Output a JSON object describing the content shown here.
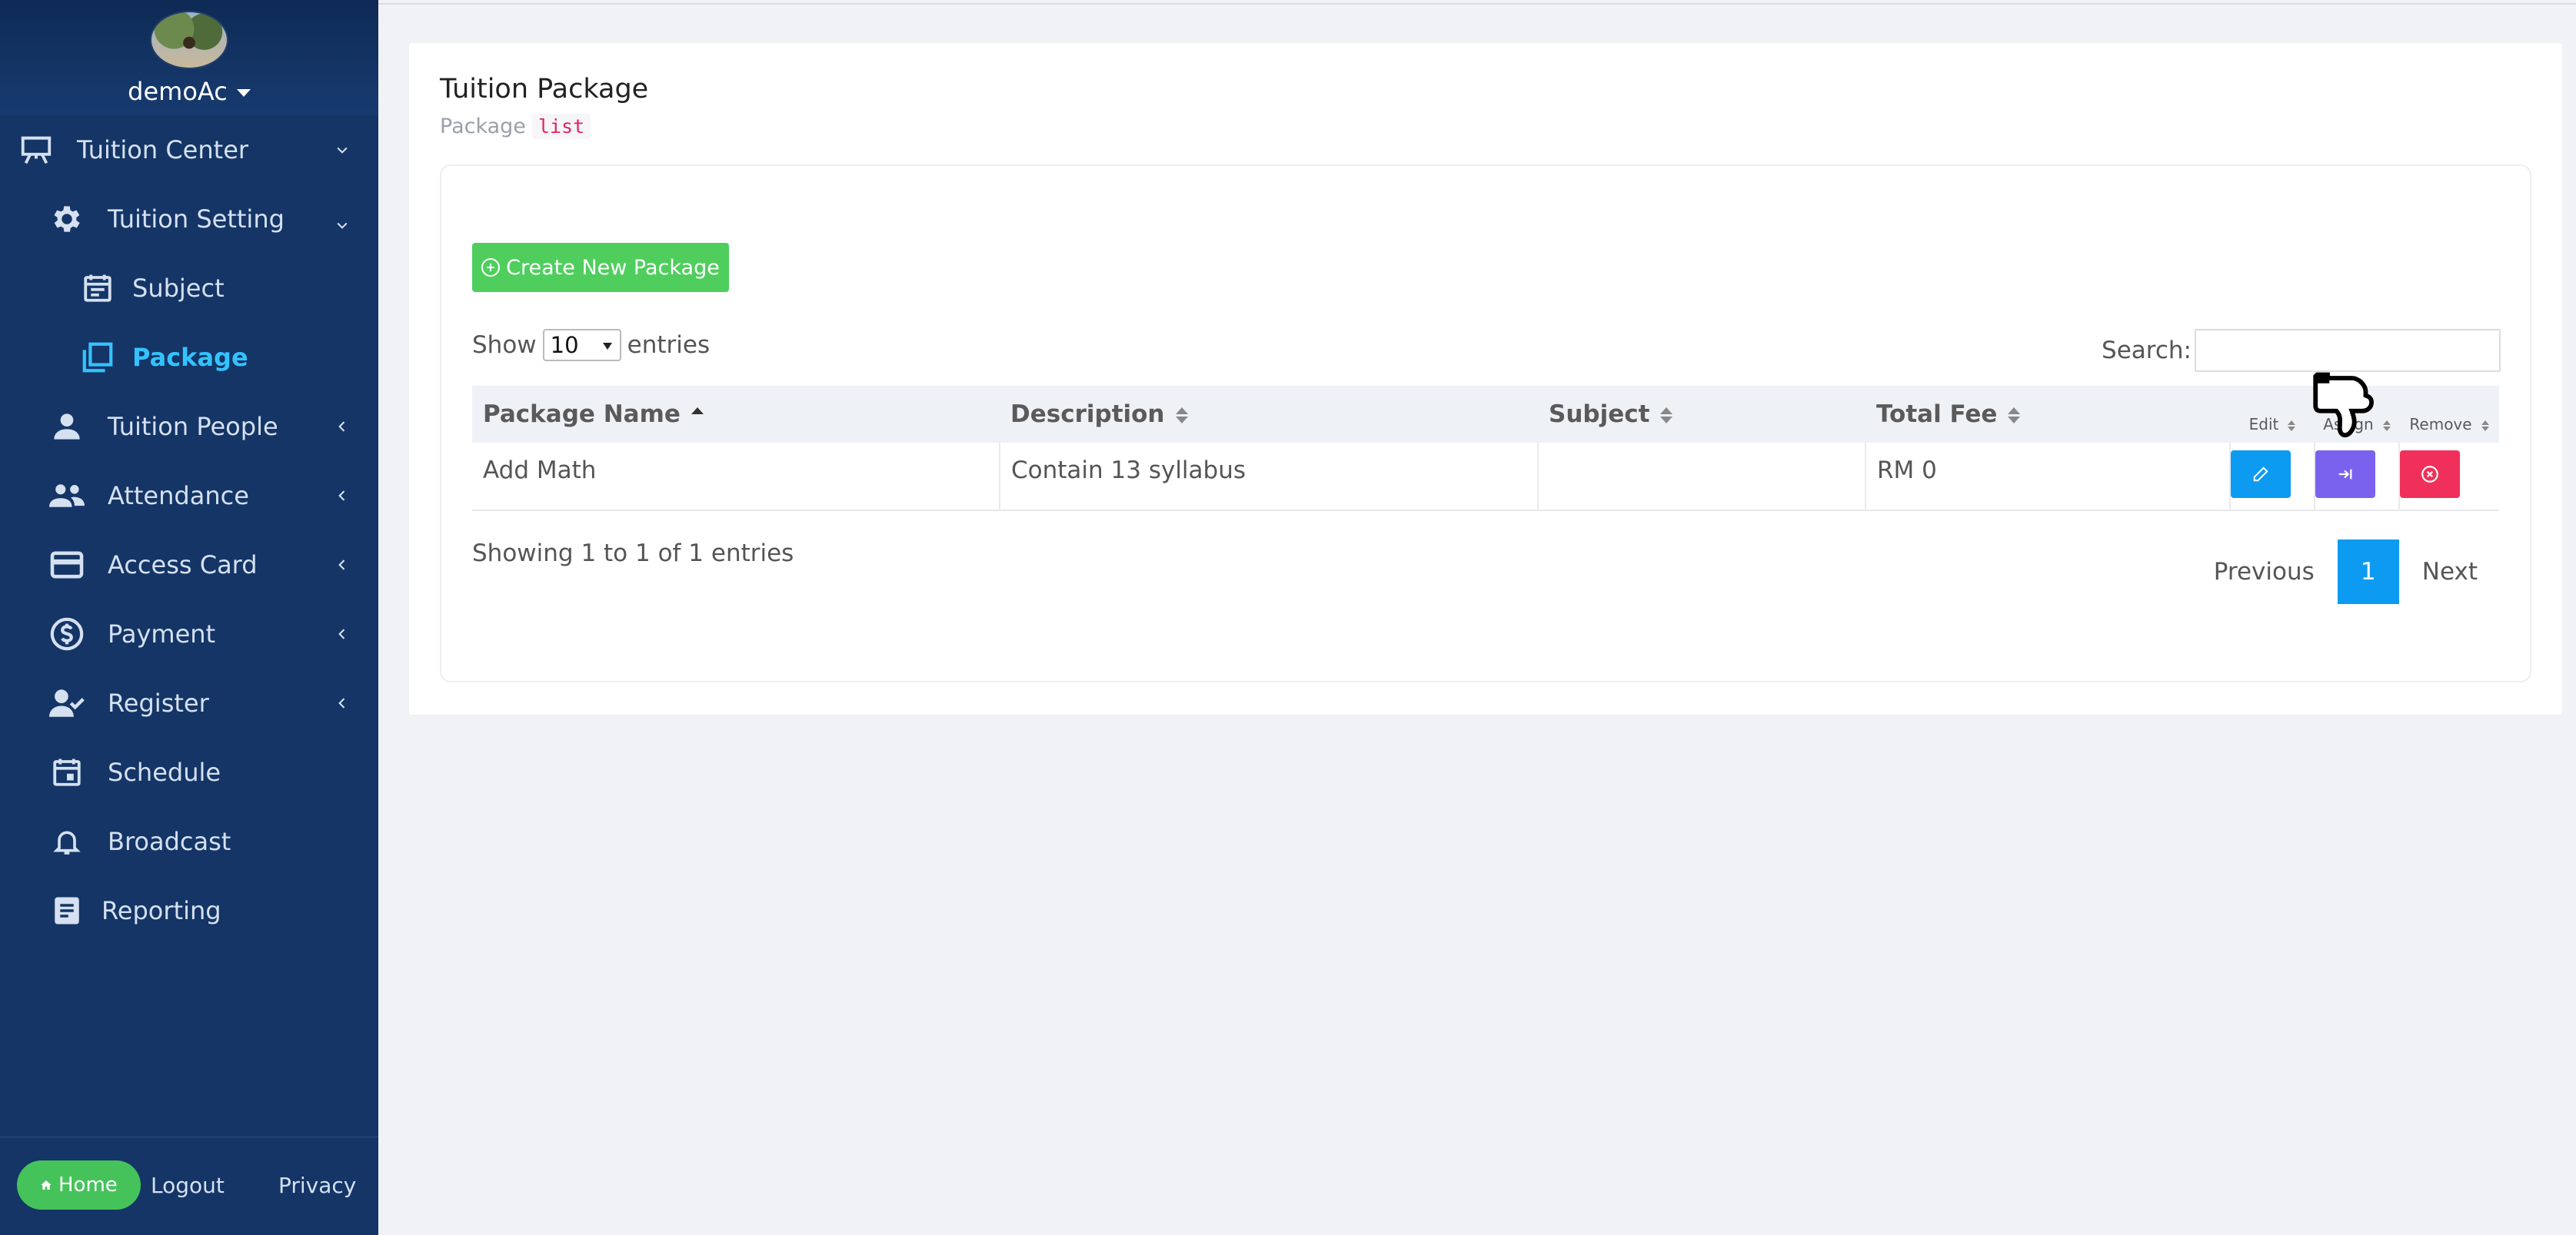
{
  "user": {
    "name": "demoAc"
  },
  "menu": [
    {
      "label": "Tuition Center",
      "icon": "presentation-board-icon",
      "arrow": "chevron-down"
    },
    {
      "label": "Tuition Setting",
      "icon": "gear-icon",
      "arrow": "chevron-down"
    },
    {
      "label": "Subject",
      "icon": "calendar-list-icon",
      "arrow": ""
    },
    {
      "label": "Package",
      "icon": "copy-squares-icon",
      "arrow": "",
      "active": true
    },
    {
      "label": "Tuition People",
      "icon": "person-icon",
      "arrow": "chevron-left"
    },
    {
      "label": "Attendance",
      "icon": "people-icon",
      "arrow": "chevron-left"
    },
    {
      "label": "Access Card",
      "icon": "credit-card-icon",
      "arrow": "chevron-left"
    },
    {
      "label": "Payment",
      "icon": "dollar-circle-icon",
      "arrow": "chevron-left"
    },
    {
      "label": "Register",
      "icon": "person-check-icon",
      "arrow": "chevron-left"
    },
    {
      "label": "Schedule",
      "icon": "calendar-icon",
      "arrow": ""
    },
    {
      "label": "Broadcast",
      "icon": "bell-icon",
      "arrow": ""
    },
    {
      "label": "Reporting",
      "icon": "document-icon",
      "arrow": ""
    }
  ],
  "footer": {
    "home": "Home",
    "logout": "Logout",
    "privacy": "Privacy"
  },
  "page": {
    "title": "Tuition Package",
    "subtitle": "Package",
    "subtitle_code": "list"
  },
  "actions": {
    "create": "Create New Package"
  },
  "table_controls": {
    "show": "Show",
    "length": "10",
    "entries": "entries",
    "search_label": "Search:",
    "search_value": ""
  },
  "table": {
    "columns": [
      "Package Name",
      "Description",
      "Subject",
      "Total Fee",
      "Edit",
      "Assign",
      "Remove"
    ],
    "rows": [
      {
        "package_name": "Add Math",
        "description": "Contain 13 syllabus",
        "subject": "",
        "total_fee": "RM 0"
      }
    ]
  },
  "pagination": {
    "info": "Showing 1 to 1 of 1 entries",
    "previous": "Previous",
    "current": "1",
    "next": "Next"
  },
  "colors": {
    "sidebar": "#143566",
    "active": "#34c3ff",
    "green": "#4fce5d",
    "blue": "#0d9bf2",
    "purple": "#7b62ee",
    "red": "#f0305a"
  }
}
